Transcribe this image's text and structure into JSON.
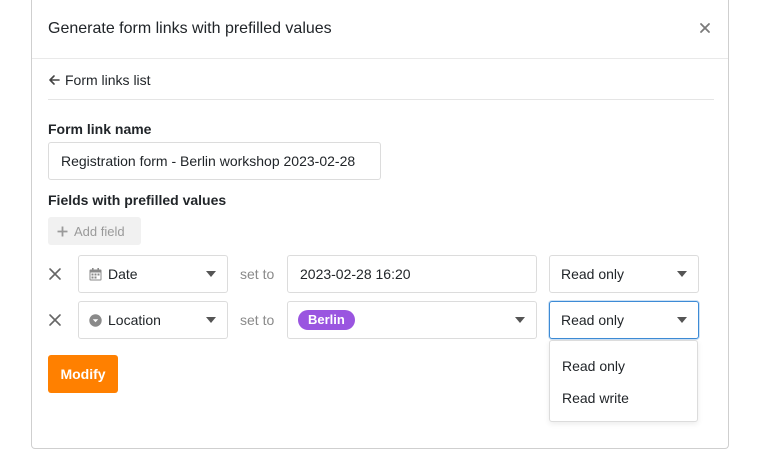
{
  "dialog": {
    "title": "Generate form links with prefilled values",
    "back_link": "Form links list",
    "form_link_name_label": "Form link name",
    "form_link_name_value": "Registration form - Berlin workshop 2023-02-28",
    "fields_label": "Fields with prefilled values",
    "add_field_label": "Add field",
    "set_to_label": "set to",
    "modify_label": "Modify"
  },
  "rows": [
    {
      "field": "Date",
      "field_icon": "calendar-icon",
      "value": "2023-02-28 16:20",
      "mode": "Read only"
    },
    {
      "field": "Location",
      "field_icon": "single-select-icon",
      "value_chip": "Berlin",
      "chip_color": "#9a55e0",
      "mode": "Read only"
    }
  ],
  "mode_dropdown": {
    "options": [
      "Read only",
      "Read write"
    ]
  },
  "colors": {
    "accent": "#ff8000",
    "focus_border": "#3d8bd6"
  }
}
